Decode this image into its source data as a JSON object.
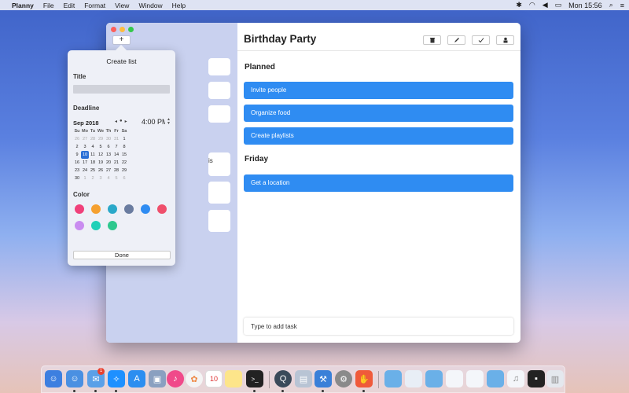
{
  "menubar": {
    "app_name": "Planny",
    "items": [
      "File",
      "Edit",
      "Format",
      "View",
      "Window",
      "Help"
    ],
    "clock": "Mon 15:56"
  },
  "window": {
    "add_button": "+",
    "list_title": "Birthday Party",
    "sidebar_card_text": "is",
    "sections": [
      {
        "title": "Planned",
        "tasks": [
          "Invite people",
          "Organize food",
          "Create playlists"
        ]
      },
      {
        "title": "Friday",
        "tasks": [
          "Get a location"
        ]
      }
    ],
    "task_input_placeholder": "Type to add task",
    "toolbar_icons": [
      "trash-icon",
      "pencil-icon",
      "checkmark-icon",
      "share-icon"
    ]
  },
  "popover": {
    "title": "Create list",
    "title_label": "Title",
    "title_value": "",
    "deadline_label": "Deadline",
    "month": "Sep 2018",
    "time": "4:00 PM",
    "weekdays": [
      "Su",
      "Mo",
      "Tu",
      "We",
      "Th",
      "Fr",
      "Sa"
    ],
    "calendar_days": [
      "26",
      "27",
      "28",
      "29",
      "30",
      "31",
      "1",
      "2",
      "3",
      "4",
      "5",
      "6",
      "7",
      "8",
      "9",
      "10",
      "11",
      "12",
      "13",
      "14",
      "15",
      "16",
      "17",
      "18",
      "19",
      "20",
      "21",
      "22",
      "23",
      "24",
      "25",
      "26",
      "27",
      "28",
      "29",
      "30",
      "1",
      "2",
      "3",
      "4",
      "5",
      "6"
    ],
    "selected_day": "10",
    "color_label": "Color",
    "colors": [
      "#f0407a",
      "#f5a030",
      "#2aa8c9",
      "#6a7ca0",
      "#2f8cf2",
      "#ef4f6b",
      "#c98cf0",
      "#22d0b8",
      "#2ec88e"
    ],
    "done_label": "Done"
  },
  "dock": {
    "mail_badge": "1",
    "calendar_day": "10"
  }
}
